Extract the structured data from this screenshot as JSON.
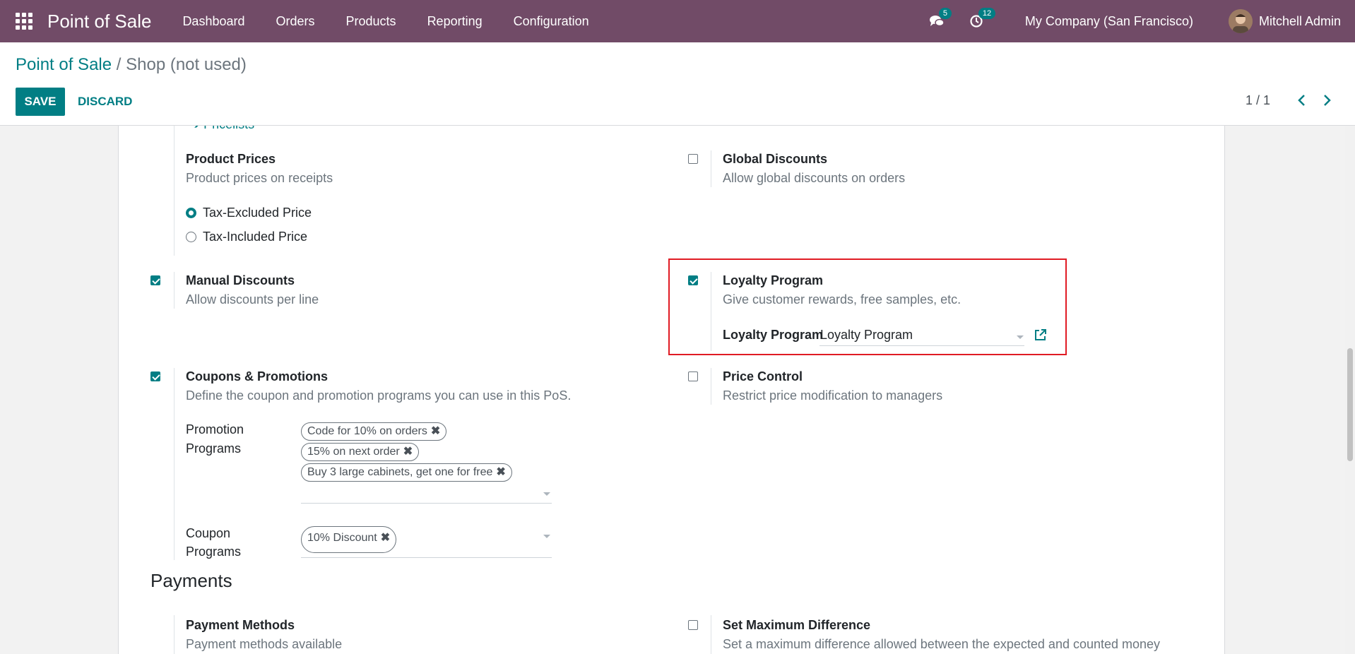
{
  "navbar": {
    "app_title": "Point of Sale",
    "menu": [
      "Dashboard",
      "Orders",
      "Products",
      "Reporting",
      "Configuration"
    ],
    "messages_count": "5",
    "activities_count": "12",
    "company": "My Company (San Francisco)",
    "user": "Mitchell Admin",
    "color": "#714B67"
  },
  "breadcrumb": {
    "parent": "Point of Sale",
    "separator": " / ",
    "current": "Shop (not used)"
  },
  "buttons": {
    "save": "SAVE",
    "discard": "DISCARD"
  },
  "pager": {
    "text": "1 / 1"
  },
  "settings": {
    "pricelists_link": "Pricelists",
    "product_prices": {
      "title": "Product Prices",
      "desc": "Product prices on receipts",
      "options": [
        "Tax-Excluded Price",
        "Tax-Included Price"
      ],
      "selected": "Tax-Excluded Price"
    },
    "global_discounts": {
      "title": "Global Discounts",
      "desc": "Allow global discounts on orders",
      "checked": false
    },
    "manual_discounts": {
      "title": "Manual Discounts",
      "desc": "Allow discounts per line",
      "checked": true
    },
    "loyalty": {
      "title": "Loyalty Program",
      "desc": "Give customer rewards, free samples, etc.",
      "field_label": "Loyalty Program",
      "field_value": "Loyalty Program",
      "checked": true
    },
    "coupons": {
      "title": "Coupons & Promotions",
      "desc": "Define the coupon and promotion programs you can use in this PoS.",
      "checked": true,
      "promotion_label_1": "Promotion",
      "promotion_label_2": "Programs",
      "promotion_tags": [
        "Code for 10% on orders",
        "15% on next order",
        "Buy 3 large cabinets, get one for free"
      ],
      "coupon_label_1": "Coupon",
      "coupon_label_2": "Programs",
      "coupon_tags": [
        "10% Discount"
      ]
    },
    "price_control": {
      "title": "Price Control",
      "desc": "Restrict price modification to managers",
      "checked": false
    }
  },
  "payments": {
    "section_title": "Payments",
    "payment_methods": {
      "title": "Payment Methods",
      "desc": "Payment methods available"
    },
    "max_difference": {
      "title": "Set Maximum Difference",
      "desc": "Set a maximum difference allowed between the expected and counted money",
      "checked": false
    }
  }
}
